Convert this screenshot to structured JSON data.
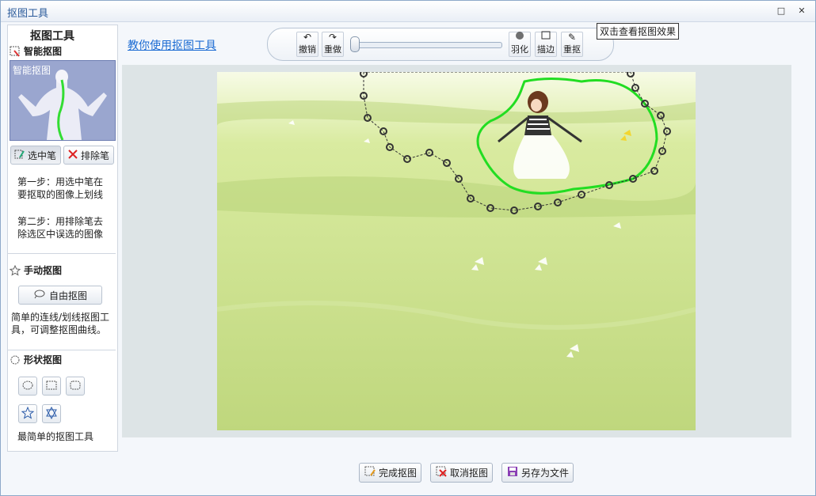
{
  "window": {
    "title": "抠图工具"
  },
  "left": {
    "title": "抠图工具",
    "smart": {
      "heading": "智能抠图",
      "thumb_label": "智能抠图",
      "select_pen": "选中笔",
      "exclude_pen": "排除笔",
      "step1": "第一步：用选中笔在要抠取的图像上划线",
      "step2": "第二步：用排除笔去除选区中误选的图像"
    },
    "manual": {
      "heading": "手动抠图",
      "free_button": "自由抠图",
      "desc": "简单的连线/划线抠图工具，可调整抠图曲线。"
    },
    "shape": {
      "heading": "形状抠图",
      "desc": "最简单的抠图工具"
    }
  },
  "help_link": "教你使用抠图工具",
  "toolbar": {
    "undo": "撤销",
    "redo": "重做",
    "feather": "羽化",
    "stroke": "描边",
    "redraw": "重抠"
  },
  "tooltip": "双击查看抠图效果",
  "bottom": {
    "finish": "完成抠图",
    "cancel": "取消抠图",
    "save_as": "另存为文件"
  },
  "colors": {
    "selection_green": "#22dd22",
    "link_blue": "#1b6bd3"
  }
}
